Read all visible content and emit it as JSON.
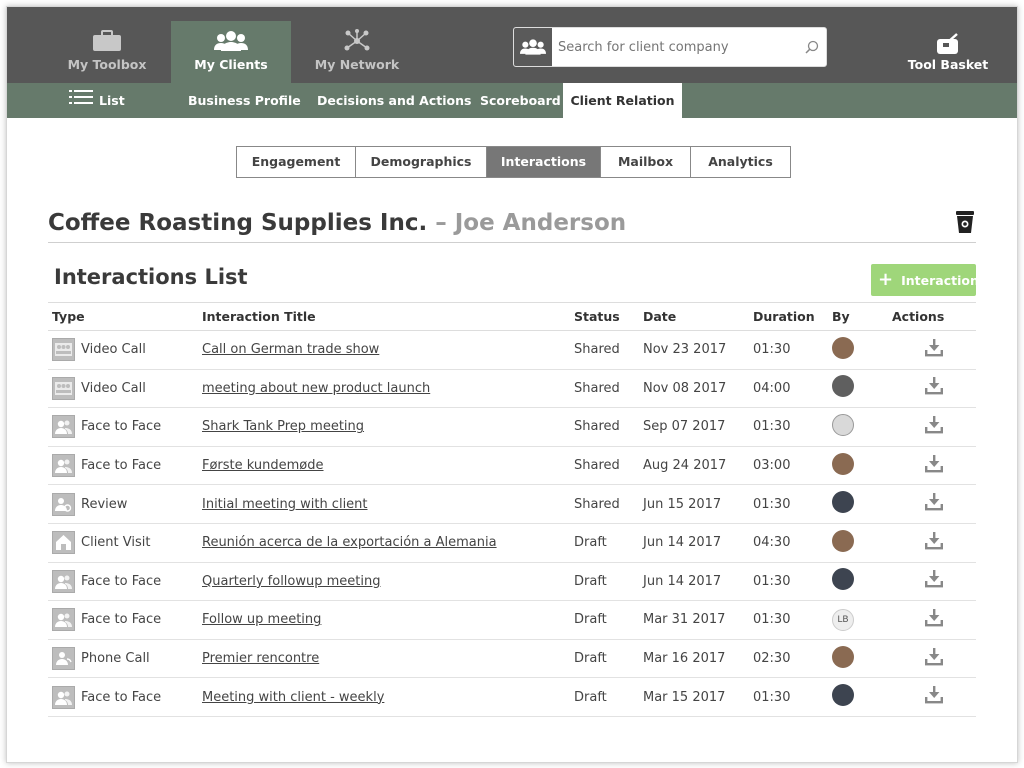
{
  "topnav": [
    {
      "label": "My Toolbox",
      "icon": "toolbox-icon"
    },
    {
      "label": "My Clients",
      "icon": "clients-icon"
    },
    {
      "label": "My Network",
      "icon": "network-icon"
    }
  ],
  "search": {
    "placeholder": "Search for client company"
  },
  "toolbasket": {
    "label": "Tool Basket"
  },
  "subnav": [
    {
      "label": "List"
    },
    {
      "label": "Business Profile"
    },
    {
      "label": "Decisions and Actions"
    },
    {
      "label": "Scoreboard"
    },
    {
      "label": "Client Relation"
    }
  ],
  "segments": [
    "Engagement",
    "Demographics",
    "Interactions",
    "Mailbox",
    "Analytics"
  ],
  "header": {
    "company": "Coffee Roasting Supplies Inc.",
    "separator": " – ",
    "person": "Joe Anderson"
  },
  "list": {
    "title": "Interactions List",
    "add_label": "Interaction"
  },
  "columns": [
    "Type",
    "Interaction Title",
    "Status",
    "Date",
    "Duration",
    "By",
    "Actions"
  ],
  "rows": [
    {
      "type": "Video Call",
      "title": "Call on German trade show",
      "status": "Shared",
      "date": "Nov 23 2017",
      "duration": "01:30",
      "by": ""
    },
    {
      "type": "Video Call",
      "title": "meeting about new product launch",
      "status": "Shared",
      "date": "Nov 08 2017",
      "duration": "04:00",
      "by": ""
    },
    {
      "type": "Face to Face",
      "title": "Shark Tank Prep meeting",
      "status": "Shared",
      "date": "Sep 07 2017",
      "duration": "01:30",
      "by": ""
    },
    {
      "type": "Face to Face",
      "title": "Første kundemøde",
      "status": "Shared",
      "date": "Aug 24 2017",
      "duration": "03:00",
      "by": ""
    },
    {
      "type": "Review",
      "title": "Initial meeting with client",
      "status": "Shared",
      "date": "Jun 15 2017",
      "duration": "01:30",
      "by": ""
    },
    {
      "type": "Client Visit",
      "title": "Reunión acerca de la exportación a Alemania",
      "status": "Draft",
      "date": "Jun 14 2017",
      "duration": "04:30",
      "by": ""
    },
    {
      "type": "Face to Face",
      "title": "Quarterly followup meeting",
      "status": "Draft",
      "date": "Jun 14 2017",
      "duration": "01:30",
      "by": ""
    },
    {
      "type": "Face to Face",
      "title": "Follow up meeting",
      "status": "Draft",
      "date": "Mar 31 2017",
      "duration": "01:30",
      "by": "LB"
    },
    {
      "type": "Phone Call",
      "title": "Premier rencontre",
      "status": "Draft",
      "date": "Mar 16 2017",
      "duration": "02:30",
      "by": ""
    },
    {
      "type": "Face to Face",
      "title": "Meeting with client - weekly",
      "status": "Draft",
      "date": "Mar 15 2017",
      "duration": "01:30",
      "by": ""
    }
  ],
  "colors": {
    "topbar": "#575757",
    "subbar": "#667a6b",
    "accent_green": "#9fd67a",
    "active_segment": "#777777"
  }
}
